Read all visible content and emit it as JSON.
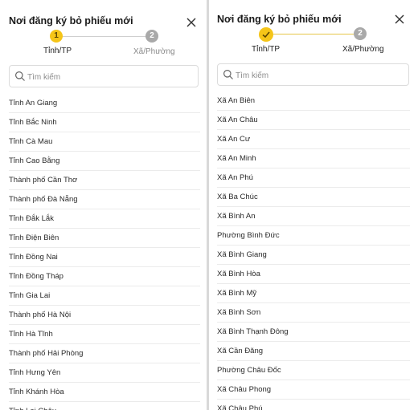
{
  "left": {
    "title": "Nơi đăng ký bỏ phiếu mới",
    "stepper": {
      "step1_number": "1",
      "step1_label": "Tỉnh/TP",
      "step2_number": "2",
      "step2_label": "Xã/Phường"
    },
    "search_placeholder": "Tìm kiếm",
    "items": [
      "Tỉnh An Giang",
      "Tỉnh Bắc Ninh",
      "Tỉnh Cà Mau",
      "Tỉnh Cao Bằng",
      "Thành phố Cần Thơ",
      "Thành phố Đà Nẵng",
      "Tỉnh Đắk Lắk",
      "Tỉnh Điện Biên",
      "Tỉnh Đồng Nai",
      "Tỉnh Đồng Tháp",
      "Tỉnh Gia Lai",
      "Thành phố Hà Nội",
      "Tỉnh Hà Tĩnh",
      "Thành phố Hải Phòng",
      "Tỉnh Hưng Yên",
      "Tỉnh Khánh Hòa",
      "Tỉnh Lai Châu"
    ]
  },
  "right": {
    "title": "Nơi đăng ký bỏ phiếu mới",
    "stepper": {
      "step1_label": "Tỉnh/TP",
      "step2_number": "2",
      "step2_label": "Xã/Phường"
    },
    "search_placeholder": "Tìm kiếm",
    "items": [
      "Xã An Biên",
      "Xã An Châu",
      "Xã An Cư",
      "Xã An Minh",
      "Xã An Phú",
      "Xã Ba Chúc",
      "Xã Bình An",
      "Phường Bình Đức",
      "Xã Bình Giang",
      "Xã Bình Hòa",
      "Xã Bình Mỹ",
      "Xã Bình Sơn",
      "Xã Bình Thạnh Đông",
      "Xã Cần Đăng",
      "Phường Châu Đốc",
      "Xã Châu Phong",
      "Xã Châu Phú"
    ]
  },
  "colors": {
    "accent": "#f5c518",
    "inactive_step": "#a9a9a9",
    "divider": "#d9d9d9"
  },
  "icons": [
    "close-icon",
    "search-icon",
    "check-icon"
  ]
}
